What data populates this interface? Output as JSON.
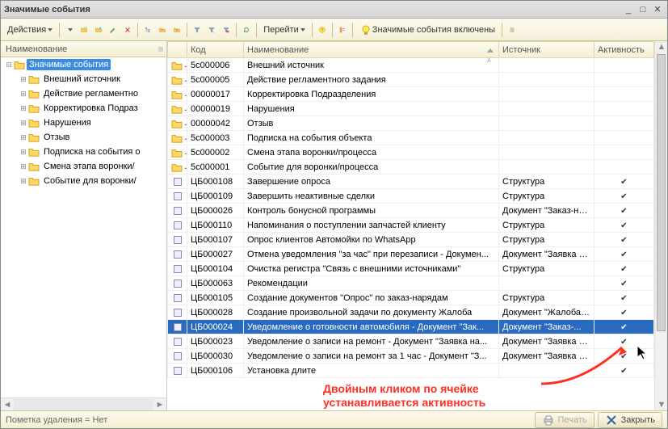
{
  "window": {
    "title": "Значимые события"
  },
  "toolbar": {
    "actions_label": "Действия",
    "goto_label": "Перейти",
    "status_label": "Значимые события включены"
  },
  "tree": {
    "header": "Наименование",
    "items": [
      {
        "label": "Значимые события",
        "expanded": true,
        "selected": true,
        "depth": 0
      },
      {
        "label": "Внешний источник",
        "depth": 1
      },
      {
        "label": "Действие регламентно",
        "depth": 1
      },
      {
        "label": "Корректировка Подраз",
        "depth": 1
      },
      {
        "label": "Нарушения",
        "depth": 1
      },
      {
        "label": "Отзыв",
        "depth": 1
      },
      {
        "label": "Подписка на события о",
        "depth": 1
      },
      {
        "label": "Смена этапа воронки/",
        "depth": 1
      },
      {
        "label": "Событие для воронки/",
        "depth": 1
      }
    ]
  },
  "grid": {
    "columns": {
      "icon": "",
      "code": "Код",
      "name": "Наименование",
      "source": "Источник",
      "activity": "Активность"
    },
    "rows": [
      {
        "folder": true,
        "code": "5c000006",
        "name": "Внешний источник",
        "source": "",
        "active": false
      },
      {
        "folder": true,
        "code": "5c000005",
        "name": "Действие регламентного задания",
        "source": "",
        "active": false
      },
      {
        "folder": true,
        "code": "00000017",
        "name": "Корректировка Подразделения",
        "source": "",
        "active": false
      },
      {
        "folder": true,
        "code": "00000019",
        "name": "Нарушения",
        "source": "",
        "active": false
      },
      {
        "folder": true,
        "code": "00000042",
        "name": "Отзыв",
        "source": "",
        "active": false
      },
      {
        "folder": true,
        "code": "5c000003",
        "name": "Подписка на события объекта",
        "source": "",
        "active": false
      },
      {
        "folder": true,
        "code": "5c000002",
        "name": "Смена этапа воронки/процесса",
        "source": "",
        "active": false
      },
      {
        "folder": true,
        "code": "5c000001",
        "name": "Событие для воронки/процесса",
        "source": "",
        "active": false
      },
      {
        "folder": false,
        "code": "ЦБ000108",
        "name": "Завершение опроса",
        "source": "Структура",
        "active": true
      },
      {
        "folder": false,
        "code": "ЦБ000109",
        "name": "Завершить неактивные сделки",
        "source": "Структура",
        "active": true
      },
      {
        "folder": false,
        "code": "ЦБ000026",
        "name": "Контроль бонусной программы",
        "source": "Документ \"Заказ-на...",
        "active": true
      },
      {
        "folder": false,
        "code": "ЦБ000110",
        "name": "Напоминания о поступлении запчастей клиенту",
        "source": "Структура",
        "active": true
      },
      {
        "folder": false,
        "code": "ЦБ000107",
        "name": "Опрос клиентов Автомойки по WhatsApp",
        "source": "Структура",
        "active": true
      },
      {
        "folder": false,
        "code": "ЦБ000027",
        "name": "Отмена уведомления \"за час\" при перезаписи - Докумен...",
        "source": "Документ \"Заявка н...",
        "active": true
      },
      {
        "folder": false,
        "code": "ЦБ000104",
        "name": "Очистка регистра \"Связь с внешними источниками\"",
        "source": "Структура",
        "active": true
      },
      {
        "folder": false,
        "code": "ЦБ000063",
        "name": "Рекомендации",
        "source": "",
        "active": true
      },
      {
        "folder": false,
        "code": "ЦБ000105",
        "name": "Создание документов \"Опрос\" по заказ-нарядам",
        "source": "Структура",
        "active": true
      },
      {
        "folder": false,
        "code": "ЦБ000028",
        "name": "Создание произвольной задачи по документу Жалоба",
        "source": "Документ \"Жалоба ...",
        "active": true
      },
      {
        "folder": false,
        "code": "ЦБ000024",
        "name": "Уведомление о готовности автомобиля - Документ \"Зак...",
        "source": "Документ \"Заказ-...",
        "active": true,
        "selected": true
      },
      {
        "folder": false,
        "code": "ЦБ000023",
        "name": "Уведомление о записи на ремонт - Документ \"Заявка на...",
        "source": "Документ \"Заявка н...",
        "active": true
      },
      {
        "folder": false,
        "code": "ЦБ000030",
        "name": "Уведомление о записи на ремонт за 1 час - Документ \"З...",
        "source": "Документ \"Заявка н...",
        "active": true
      },
      {
        "folder": false,
        "code": "ЦБ000106",
        "name": "Установка длите",
        "source": "",
        "active": true
      }
    ]
  },
  "footer": {
    "note": "Пометка удаления = Нет",
    "print_label": "Печать",
    "close_label": "Закрыть"
  },
  "annotation": {
    "line1": "Двойным кликом по ячейке",
    "line2": "устанавливается активность"
  }
}
